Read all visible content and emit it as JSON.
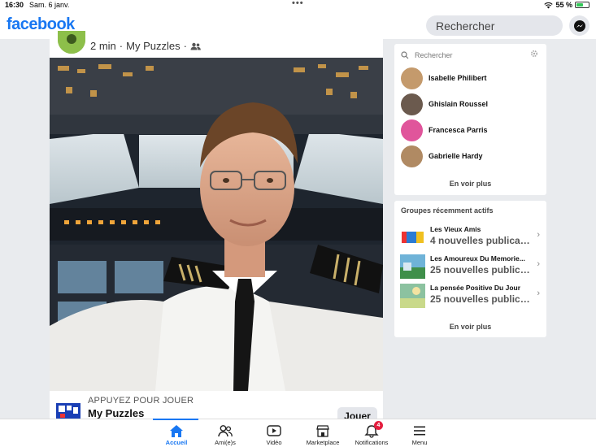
{
  "status_bar": {
    "time": "16:30",
    "date": "Sam. 6 janv.",
    "battery": "55 %",
    "battery_level": 0.55
  },
  "header": {
    "logo": "facebook",
    "search_placeholder": "Rechercher",
    "brand_color": "#1877f2"
  },
  "post": {
    "time": "2 min",
    "separator": "·",
    "source": "My Puzzles",
    "audience_icon": "friends-icon",
    "game_cta": "APPUYEZ POUR JOUER",
    "game_name": "My Puzzles",
    "play_button": "Jouer"
  },
  "contacts": {
    "search_placeholder": "Rechercher",
    "items": [
      {
        "name": "Isabelle Philibert",
        "avatar_color": "#c49a6c"
      },
      {
        "name": "Ghislain Roussel",
        "avatar_color": "#6b5a4e"
      },
      {
        "name": "Francesca Parris",
        "avatar_color": "#e0559b"
      },
      {
        "name": "Gabrielle Hardy",
        "avatar_color": "#b08a63"
      }
    ],
    "see_more": "En voir plus"
  },
  "groups": {
    "title": "Groupes récemment actifs",
    "items": [
      {
        "name": "Les Vieux Amis",
        "subtitle": "4 nouvelles publicati..."
      },
      {
        "name": "Les Amoureux Du Memorie...",
        "subtitle": "25 nouvelles publicat..."
      },
      {
        "name": "La pensée Positive Du Jour",
        "subtitle": "25 nouvelles publicat..."
      }
    ],
    "see_more": "En voir plus"
  },
  "tabs": [
    {
      "label": "Accueil",
      "icon": "home-icon",
      "active": true
    },
    {
      "label": "Ami(e)s",
      "icon": "friends-icon"
    },
    {
      "label": "Vidéo",
      "icon": "video-icon"
    },
    {
      "label": "Marketplace",
      "icon": "marketplace-icon"
    },
    {
      "label": "Notifications",
      "icon": "bell-icon",
      "badge": "4"
    },
    {
      "label": "Menu",
      "icon": "menu-icon"
    }
  ]
}
